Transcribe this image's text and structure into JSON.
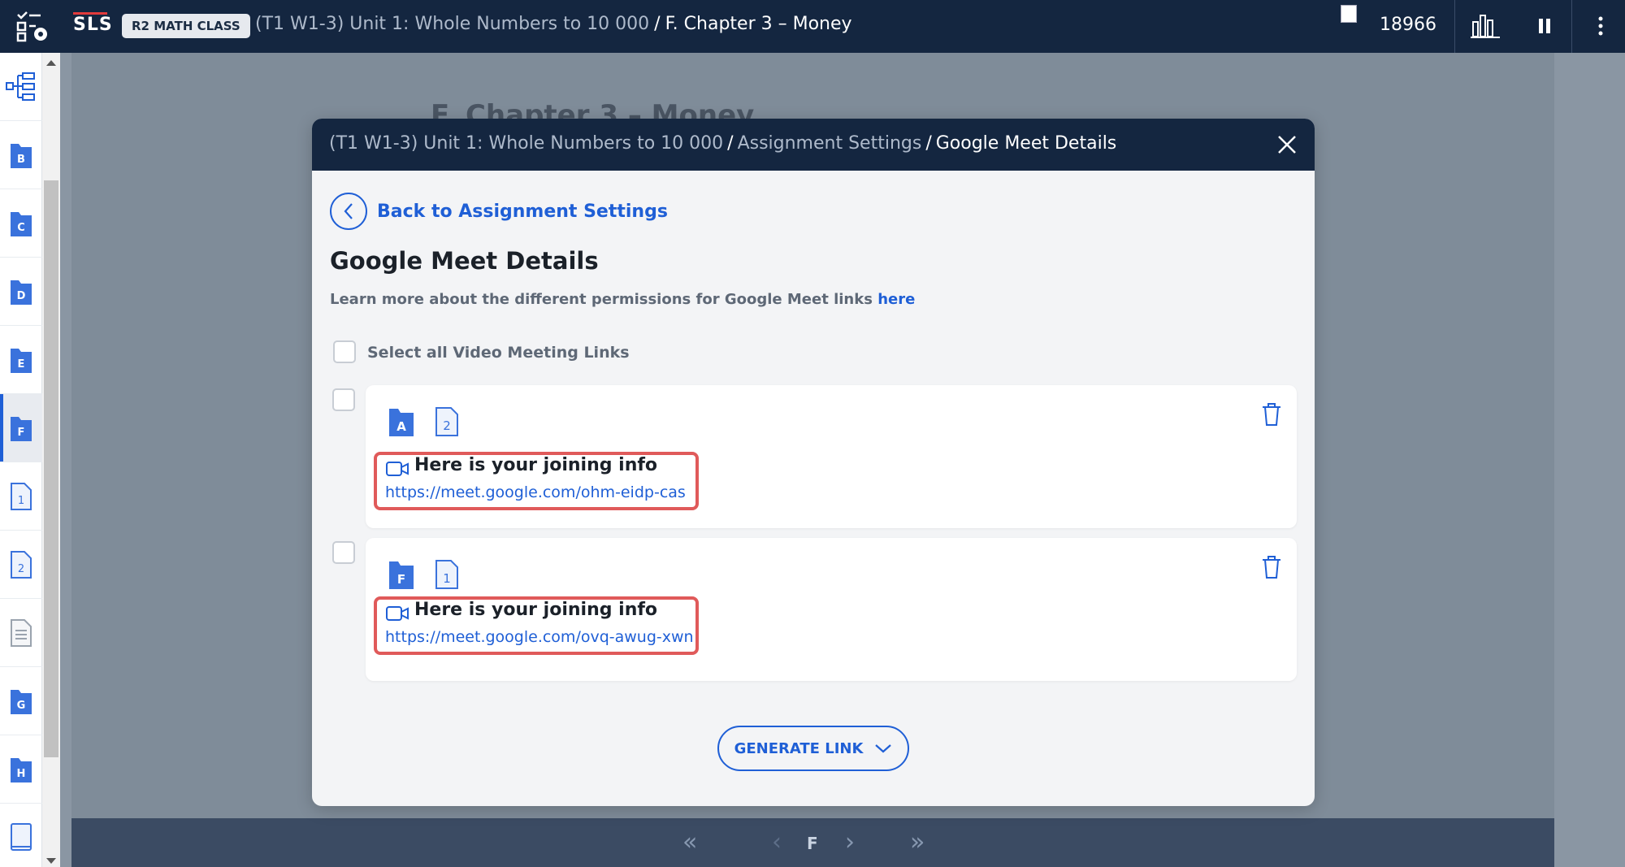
{
  "topbar": {
    "logo": "SLS",
    "class_badge": "R2 MATH CLASS",
    "crumb_parent": "(T1 W1-3) Unit 1: Whole Numbers to 10 000",
    "crumb_sep": "/",
    "crumb_current": "F. Chapter 3 – Money",
    "count": "18966",
    "icons": [
      "task-tools-icon",
      "stats-icon",
      "pause-icon",
      "more-vert-icon"
    ]
  },
  "sidebar": {
    "items": [
      {
        "label": "",
        "icon": "tree-icon"
      },
      {
        "label": "B",
        "icon": "folder-icon"
      },
      {
        "label": "C",
        "icon": "folder-icon"
      },
      {
        "label": "D",
        "icon": "folder-icon"
      },
      {
        "label": "E",
        "icon": "folder-icon"
      },
      {
        "label": "F",
        "icon": "folder-icon",
        "active": true
      },
      {
        "label": "1",
        "icon": "page-icon"
      },
      {
        "label": "2",
        "icon": "page-icon"
      },
      {
        "label": "",
        "icon": "doc-icon"
      },
      {
        "label": "G",
        "icon": "folder-icon"
      },
      {
        "label": "H",
        "icon": "folder-icon"
      },
      {
        "label": "",
        "icon": "book-icon"
      }
    ]
  },
  "background": {
    "title": "F. Chapter 3 – Money",
    "bottom_nav_current": "F"
  },
  "modal": {
    "crumb": {
      "part1": "(T1 W1-3) Unit 1: Whole Numbers to 10 000",
      "sep": "/",
      "part2": "Assignment Settings",
      "part3": "Google Meet Details"
    },
    "back_label": "Back to Assignment Settings",
    "title": "Google Meet Details",
    "learn_more_text": "Learn more about the different permissions for Google Meet links",
    "learn_more_link": "here",
    "select_all_label": "Select all Video Meeting Links",
    "cards": [
      {
        "folder": "A",
        "page": "2",
        "join_title": "Here is your joining info",
        "link": "https://meet.google.com/ohm-eidp-cas"
      },
      {
        "folder": "F",
        "page": "1",
        "join_title": "Here is your joining info",
        "link": "https://meet.google.com/ovq-awug-xwn"
      }
    ],
    "generate_label": "GENERATE LINK"
  },
  "colors": {
    "navy": "#142640",
    "accent": "#1f5fd6",
    "highlight": "#e05a5a"
  }
}
